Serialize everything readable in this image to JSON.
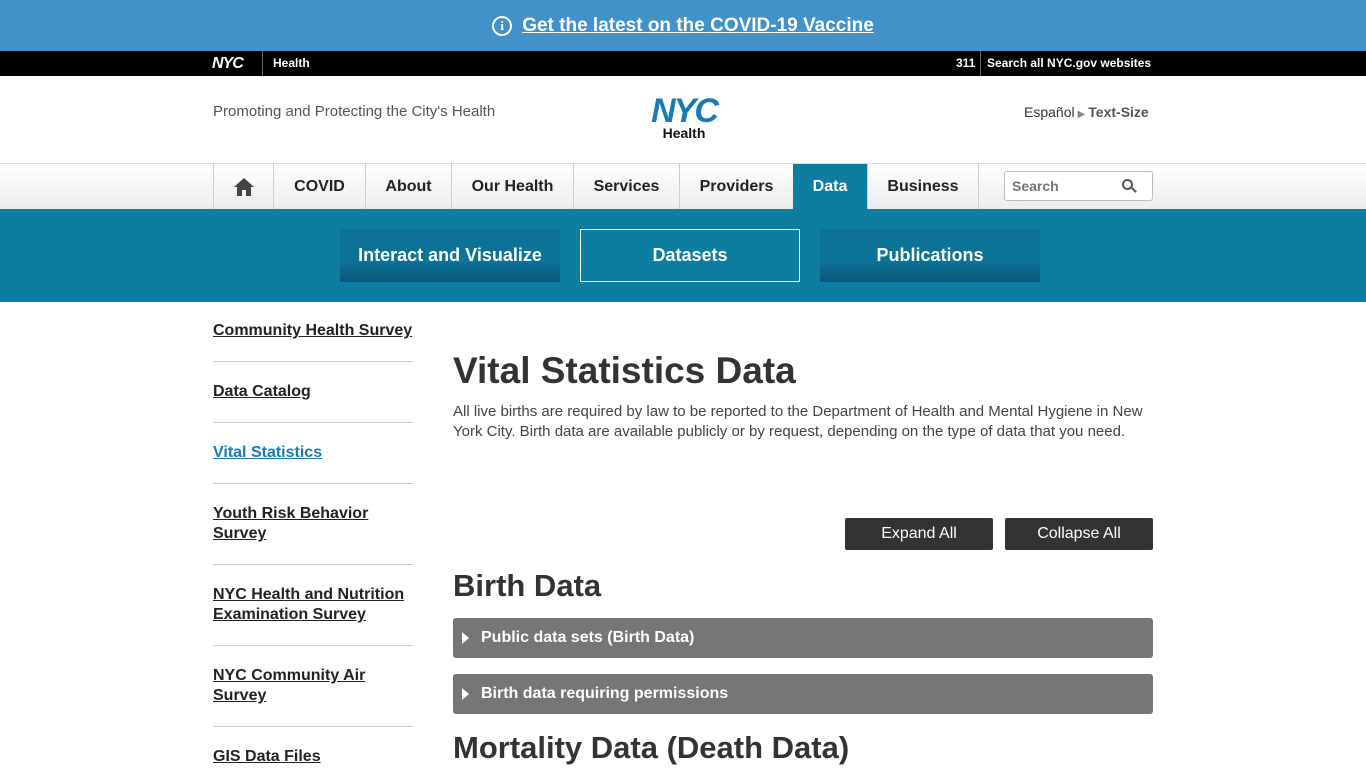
{
  "alert": {
    "text": "Get the latest on the COVID-19 Vaccine",
    "icon": "info-icon"
  },
  "topbar": {
    "nyc": "NYC",
    "health": "Health",
    "l311": "311",
    "search_all": "Search all NYC.gov websites"
  },
  "header": {
    "tagline": "Promoting and Protecting the City's Health",
    "logo_nyc": "NYC",
    "logo_health": "Health",
    "espanol": "Español",
    "text_size": "Text-Size"
  },
  "nav": {
    "items": [
      "COVID",
      "About",
      "Our Health",
      "Services",
      "Providers",
      "Data",
      "Business"
    ],
    "active": "Data",
    "search_placeholder": "Search"
  },
  "subnav": [
    "Interact and Visualize",
    "Datasets",
    "Publications"
  ],
  "sidebar": [
    "Community Health Survey",
    "Data Catalog",
    "Vital Statistics",
    "Youth Risk Behavior Survey",
    "NYC Health and Nutrition Examination Survey",
    "NYC Community Air Survey",
    "GIS Data Files"
  ],
  "main": {
    "title": "Vital Statistics Data",
    "intro": "All live births are required by law to be reported to the Department of Health and Mental Hygiene in New York City. Birth data are available publicly or by request, depending on the type of data that you need.",
    "expand_all": "Expand All",
    "collapse_all": "Collapse All",
    "birth_heading": "Birth Data",
    "acc1": "Public data sets (Birth Data)",
    "acc2": "Birth data requiring permissions",
    "mortality_heading": "Mortality Data (Death Data)"
  },
  "colors": {
    "brand_blue": "#0e7ea0",
    "alert_blue": "#4291c9",
    "link_blue": "#1a7ab5",
    "accordion_gray": "#767676"
  }
}
